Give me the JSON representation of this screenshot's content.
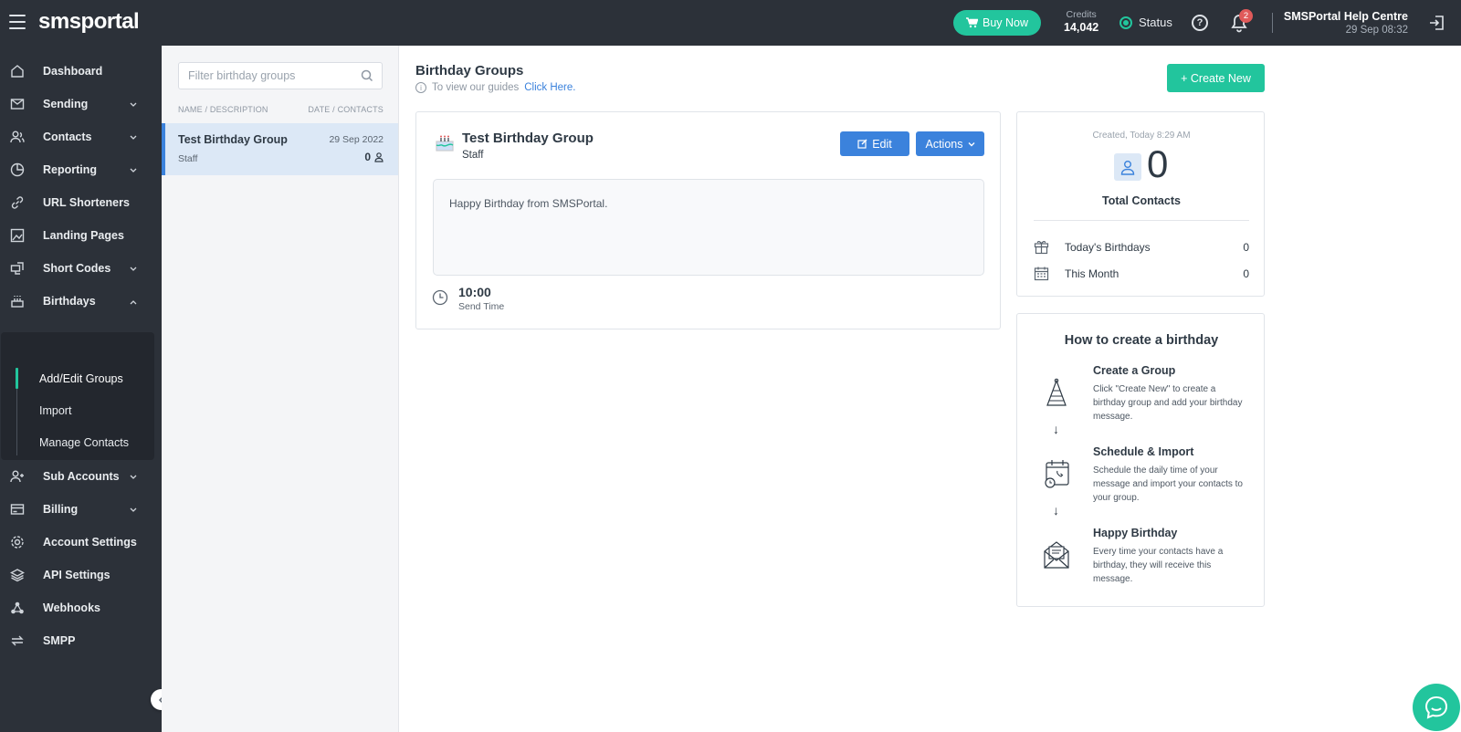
{
  "topbar": {
    "logo": "smsportal",
    "buy_label": "Buy Now",
    "credits_label": "Credits",
    "credits_value": "14,042",
    "status_label": "Status",
    "notification_count": "2",
    "user_name": "SMSPortal Help Centre",
    "user_date": "29 Sep 08:32",
    "help_glyph": "?"
  },
  "sidebar": {
    "items": [
      {
        "label": "Dashboard",
        "icon": "home-icon"
      },
      {
        "label": "Sending",
        "icon": "envelope-icon"
      },
      {
        "label": "Contacts",
        "icon": "contacts-icon"
      },
      {
        "label": "Reporting",
        "icon": "pie-chart-icon"
      },
      {
        "label": "URL Shorteners",
        "icon": "link-icon"
      },
      {
        "label": "Landing Pages",
        "icon": "landing-page-icon"
      },
      {
        "label": "Short Codes",
        "icon": "short-code-icon"
      },
      {
        "label": "Birthdays",
        "icon": "cake-icon"
      },
      {
        "label": "Sub Accounts",
        "icon": "user-plus-icon"
      },
      {
        "label": "Billing",
        "icon": "credit-card-icon"
      },
      {
        "label": "Account Settings",
        "icon": "gear-icon"
      },
      {
        "label": "API Settings",
        "icon": "layers-icon"
      },
      {
        "label": "Webhooks",
        "icon": "webhook-icon"
      },
      {
        "label": "SMPP",
        "icon": "swap-icon"
      }
    ],
    "birthdays_sub": [
      "Add/Edit Groups",
      "Import",
      "Manage Contacts"
    ]
  },
  "list": {
    "filter_placeholder": "Filter birthday groups",
    "col_name": "NAME / DESCRIPTION",
    "col_date": "DATE / CONTACTS",
    "rows": [
      {
        "title": "Test Birthday Group",
        "date": "29 Sep 2022",
        "sub": "Staff",
        "count": "0"
      }
    ]
  },
  "main": {
    "title": "Birthday Groups",
    "guide_text": "To view our guides",
    "guide_link": "Click Here.",
    "create_label": "+ Create New",
    "group": {
      "title": "Test Birthday Group",
      "sub": "Staff",
      "edit_label": "Edit",
      "actions_label": "Actions",
      "message": "Happy Birthday from SMSPortal.",
      "send_time": "10:00",
      "send_time_label": "Send Time"
    },
    "stats": {
      "created": "Created, Today 8:29 AM",
      "total": "0",
      "total_label": "Total Contacts",
      "today_label": "Today's Birthdays",
      "today_value": "0",
      "month_label": "This Month",
      "month_value": "0"
    },
    "howto": {
      "title": "How to create a birthday",
      "steps": [
        {
          "title": "Create a Group",
          "desc": "Click \"Create New\" to create a birthday group and add your birthday message.",
          "icon": "party-hat-icon"
        },
        {
          "title": "Schedule & Import",
          "desc": "Schedule the daily time of your message and import your contacts to your group.",
          "icon": "schedule-icon"
        },
        {
          "title": "Happy Birthday",
          "desc": "Every time your contacts have a birthday, they will receive this message.",
          "icon": "envelope-open-icon"
        }
      ],
      "arrow": "↓"
    }
  },
  "colors": {
    "accent": "#22c59d",
    "primary": "#3b82dc",
    "sidebar": "#2c3139"
  }
}
